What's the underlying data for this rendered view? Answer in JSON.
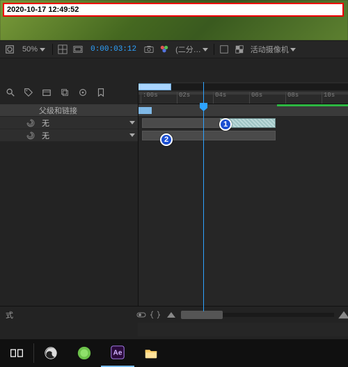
{
  "timestamp": "2020-10-17 12:49:52",
  "toolbar": {
    "zoom": "50%",
    "timecode": "0:00:03:12",
    "preset_label": "(二分…",
    "camera_label": "活动摄像机"
  },
  "layer_panel": {
    "parent_header": "父级和链接",
    "layers": [
      {
        "parent": "无"
      },
      {
        "parent": "无"
      }
    ]
  },
  "time_ruler": {
    "ticks": [
      ":00s",
      "02s",
      "04s",
      "06s",
      "08s",
      "10s"
    ]
  },
  "footer": {
    "left_label": "式"
  },
  "annotations": [
    {
      "n": "1"
    },
    {
      "n": "2"
    }
  ],
  "colors": {
    "playhead": "#2ea3ff",
    "badge": "#1c4fd1",
    "green": "#2db842"
  }
}
